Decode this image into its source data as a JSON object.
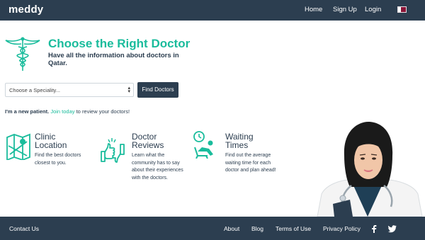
{
  "header": {
    "brand": "meddy",
    "nav": {
      "home": "Home",
      "signup": "Sign Up",
      "login": "Login"
    },
    "flag_icon": "qatar-flag-icon"
  },
  "hero": {
    "title": "Choose the Right Doctor",
    "subtitle": "Have all the information about doctors in Qatar.",
    "logo_icon": "caduceus-icon"
  },
  "search": {
    "speciality_selected": "Choose a Speciality...",
    "button_label": "Find Doctors"
  },
  "new_patient": {
    "bold": "I'm a new patient.",
    "link": "Join today",
    "rest": " to review your doctors!"
  },
  "features": [
    {
      "icon": "map-pin-icon",
      "title_line1": "Clinic",
      "title_line2": "Location",
      "desc": "Find the best doctors closest to you."
    },
    {
      "icon": "thumbs-up-down-icon",
      "title_line1": "Doctor",
      "title_line2": "Reviews",
      "desc": "Learn what the community has to say about their experiences with the doctors."
    },
    {
      "icon": "clock-waiting-icon",
      "title_line1": "Waiting",
      "title_line2": "Times",
      "desc": "Find out the average waiting time for each doctor and plan ahead!"
    }
  ],
  "footer": {
    "contact": "Contact Us",
    "about": "About",
    "blog": "Blog",
    "terms": "Terms of Use",
    "privacy": "Privacy Policy",
    "facebook_icon": "facebook-icon",
    "twitter_icon": "twitter-icon"
  },
  "colors": {
    "navy": "#2c3e50",
    "teal": "#1abc9c"
  }
}
